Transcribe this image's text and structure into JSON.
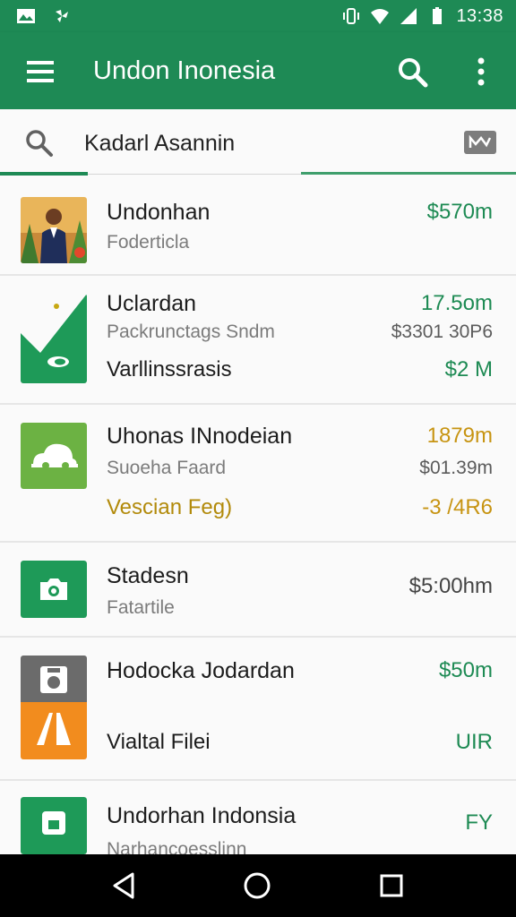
{
  "status_bar": {
    "time": "13:38",
    "icons": [
      "gallery-icon",
      "pinwheel-icon",
      "vibrate-icon",
      "wifi-icon",
      "signal-icon",
      "battery-icon"
    ]
  },
  "app_bar": {
    "title": "Undon Inonesia",
    "icons": [
      "menu-icon",
      "search-icon",
      "more-vert-icon"
    ]
  },
  "search": {
    "value": "Kadarl Asannin",
    "badge_icon": "media-badge-icon"
  },
  "items": [
    {
      "title": "Undonhan",
      "subtitle": "Foderticla",
      "value": "$570m",
      "value_color": "#1d8a53"
    },
    {
      "title": "Uclardan",
      "subtitle": "Packrunctags Sndm",
      "extra": "Varllinssrasis",
      "value": "17.5om",
      "value2": "$3301 30P6",
      "value3": "$2 M"
    },
    {
      "title": "Uhonas INnodeian",
      "subtitle": "Suoeha Faard",
      "extra": "Vescian Feg)",
      "value": "1879m",
      "value2": "$01.39m",
      "value3": "-3 /4R6"
    },
    {
      "title": "Stadesn",
      "subtitle": "Fatartile",
      "value": "$5:00hm"
    },
    {
      "title": "Hodocka Jodardan",
      "extra": "Vialtal Filei",
      "value": "$50m",
      "value3": "UIR"
    },
    {
      "title": "Undorhan Indonsia",
      "subtitle": "Narhancoesslinn",
      "value": "FY"
    }
  ],
  "colors": {
    "primary": "#1e8a55",
    "accent_green": "#1d8a53",
    "accent_gold": "#c79412"
  },
  "nav": {
    "icons": [
      "back-icon",
      "home-icon",
      "recents-icon"
    ]
  }
}
